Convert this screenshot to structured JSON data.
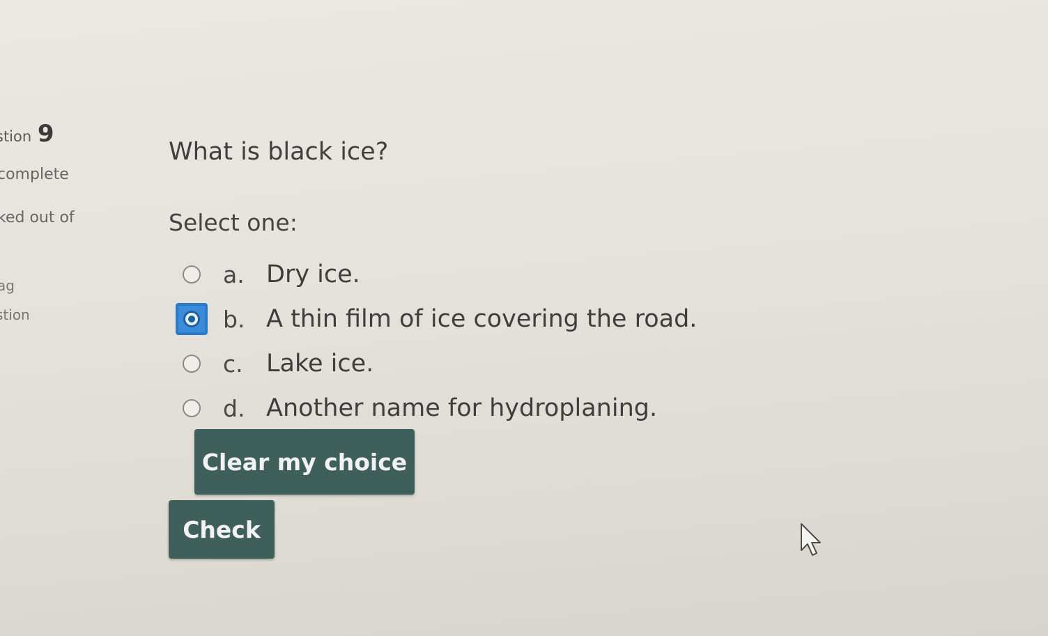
{
  "question_info": {
    "label": "stion",
    "number": "9",
    "state": "complete",
    "grade": "ked out of",
    "flag": "ag",
    "flag_text": "stion"
  },
  "question": {
    "text": "What is black ice?",
    "prompt": "Select one:"
  },
  "answers": [
    {
      "letter": "a.",
      "text": "Dry ice.",
      "selected": false
    },
    {
      "letter": "b.",
      "text": "A thin film of ice covering the road.",
      "selected": true
    },
    {
      "letter": "c.",
      "text": "Lake ice.",
      "selected": false
    },
    {
      "letter": "d.",
      "text": "Another name for hydroplaning.",
      "selected": false
    }
  ],
  "buttons": {
    "clear_label": "Clear my choice",
    "check_label": "Check"
  },
  "colors": {
    "button_bg": "#3f5f5b",
    "selected_accent": "#3a8bd8"
  }
}
